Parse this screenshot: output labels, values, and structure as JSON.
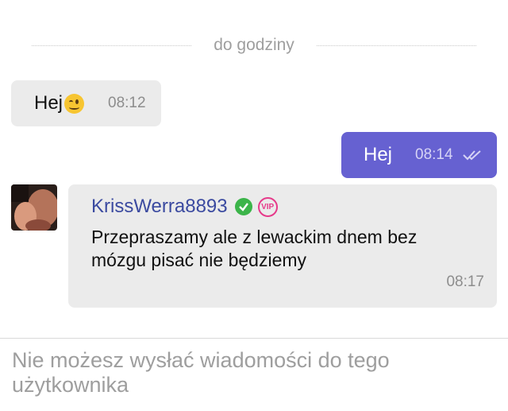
{
  "chat": {
    "divider_label": "do godziny",
    "messages": [
      {
        "direction": "incoming",
        "text": "Hej",
        "emoji": "winking-face",
        "time": "08:12"
      },
      {
        "direction": "outgoing",
        "text": "Hej",
        "time": "08:14",
        "status_icon": "double-check-icon"
      },
      {
        "direction": "incoming",
        "sender": "KrissWerra8893",
        "badges": [
          "verified-check-icon",
          "vip-badge"
        ],
        "badge_vip_text": "VIP",
        "text": "Przepraszamy ale z lewackim dnem bez mózgu pisać nie będziemy",
        "time": "08:17"
      }
    ]
  },
  "composer": {
    "disabled_notice": "Nie możesz wysłać wiadomości do tego użytkownika"
  },
  "colors": {
    "outgoing_bubble": "#6661d1",
    "incoming_bubble": "#ebebeb",
    "sender_name": "#3b4aa0",
    "verified": "#3bb449",
    "vip": "#e63a8a"
  }
}
